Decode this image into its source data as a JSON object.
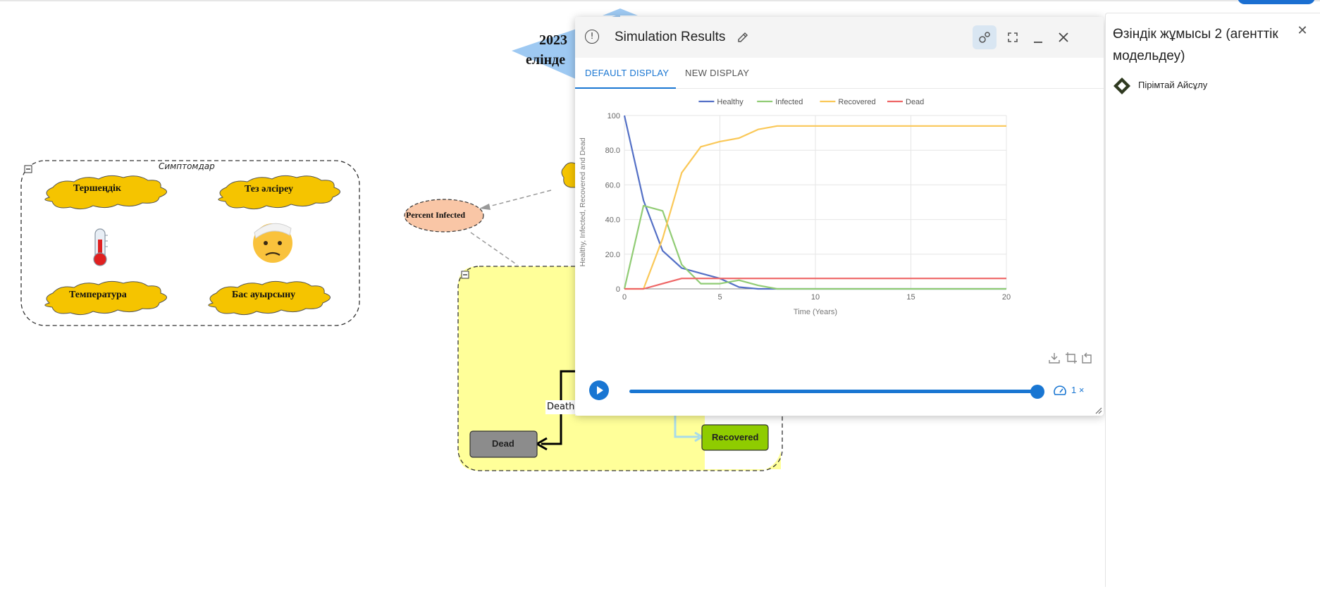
{
  "canvas": {
    "symptoms_group_label": "Симптомдар",
    "symptoms": [
      "Тершеңдік",
      "Тез әлсіреу",
      "Температура",
      "Бас ауырсыну"
    ],
    "percent_infected_label": "Percent Infected",
    "year_text_line1": "2023",
    "year_text_line2": "елінде",
    "death_flow_label": "Death",
    "dead_stock_label": "Dead",
    "recovered_stock_label": "Recovered",
    "colors": {
      "cloud": "#f5c400",
      "group_bg": "#ffff99",
      "percent_bg": "#f9c6a6",
      "recovered_bg": "#8fcc00",
      "dead_bg": "#8c8c8c"
    }
  },
  "simulation": {
    "title": "Simulation Results",
    "tabs": [
      "DEFAULT DISPLAY",
      "NEW DISPLAY"
    ],
    "active_tab": 0,
    "speed_label": "1 ×",
    "playback_position": 1.0
  },
  "chart_data": {
    "type": "line",
    "xlabel": "Time (Years)",
    "ylabel": "Healthy, Infected, Recovered and Dead",
    "xlim": [
      0,
      20
    ],
    "ylim": [
      0,
      100
    ],
    "xticks": [
      "0",
      "5",
      "10",
      "15",
      "20"
    ],
    "yticks": [
      "0",
      "20.0",
      "40.0",
      "60.0",
      "80.0",
      "100"
    ],
    "grid": true,
    "legend_position": "top",
    "x": [
      0,
      1,
      2,
      3,
      4,
      5,
      6,
      7,
      8,
      9,
      10,
      11,
      12,
      13,
      14,
      15,
      16,
      17,
      18,
      19,
      20
    ],
    "series": [
      {
        "name": "Healthy",
        "color": "#5470c6",
        "values": [
          100,
          51,
          22,
          12,
          9,
          6,
          1,
          0,
          0,
          0,
          0,
          0,
          0,
          0,
          0,
          0,
          0,
          0,
          0,
          0,
          0
        ]
      },
      {
        "name": "Infected",
        "color": "#91cc75",
        "values": [
          0,
          48,
          45,
          14,
          3,
          3,
          5,
          2,
          0,
          0,
          0,
          0,
          0,
          0,
          0,
          0,
          0,
          0,
          0,
          0,
          0
        ]
      },
      {
        "name": "Recovered",
        "color": "#fac858",
        "values": [
          0,
          0,
          29,
          67,
          82,
          85,
          87,
          92,
          94,
          94,
          94,
          94,
          94,
          94,
          94,
          94,
          94,
          94,
          94,
          94,
          94
        ]
      },
      {
        "name": "Dead",
        "color": "#ee6666",
        "values": [
          0,
          0,
          3,
          6,
          6,
          6,
          6,
          6,
          6,
          6,
          6,
          6,
          6,
          6,
          6,
          6,
          6,
          6,
          6,
          6,
          6
        ]
      }
    ]
  },
  "right_panel": {
    "title": "Өзіндік жұмысы 2 (агенттік модельдеу)",
    "author": "Пірімтай Айсұлу"
  }
}
